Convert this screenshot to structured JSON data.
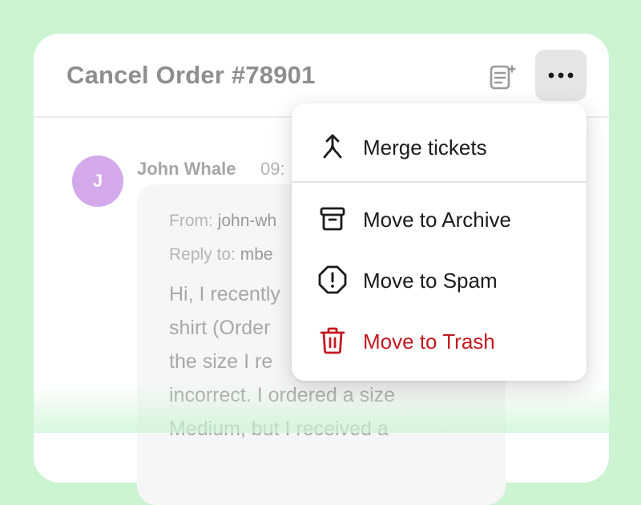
{
  "ticket": {
    "title": "Cancel Order #78901"
  },
  "message": {
    "avatar_initial": "J",
    "sender": "John Whale",
    "time": "09:",
    "from_label": "From:",
    "from_value": "john-wh",
    "reply_label": "Reply to:",
    "reply_value": "mbe",
    "body_lines": [
      "Hi, I recently",
      "shirt (Order",
      "the size I re",
      "incorrect. I ordered a size",
      "Medium, but I received a"
    ]
  },
  "menu": {
    "items": [
      {
        "label": "Merge tickets",
        "icon": "merge-icon"
      },
      {
        "label": "Move to Archive",
        "icon": "archive-icon"
      },
      {
        "label": "Move to Spam",
        "icon": "spam-icon"
      },
      {
        "label": "Move to Trash",
        "icon": "trash-icon",
        "color": "#c41921"
      }
    ]
  },
  "colors": {
    "background": "#ccf4d3",
    "avatar": "#d3a9ec",
    "danger": "#c41921"
  }
}
